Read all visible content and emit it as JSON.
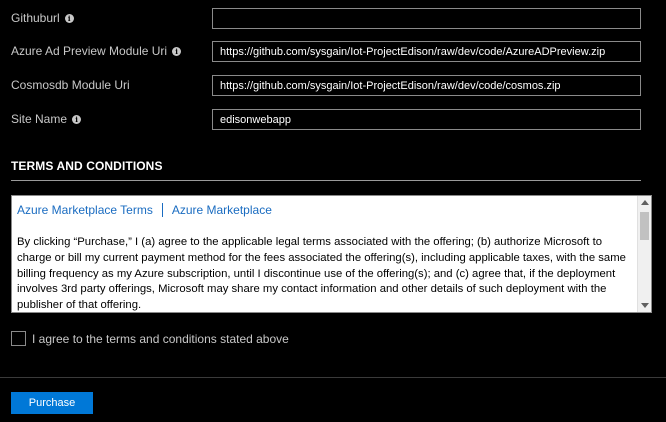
{
  "fields": [
    {
      "label": "Githuburl",
      "has_info": true,
      "value": ""
    },
    {
      "label": "Azure Ad Preview Module Uri",
      "has_info": true,
      "value": "https://github.com/sysgain/Iot-ProjectEdison/raw/dev/code/AzureADPreview.zip"
    },
    {
      "label": "Cosmosdb Module Uri",
      "has_info": false,
      "value": "https://github.com/sysgain/Iot-ProjectEdison/raw/dev/code/cosmos.zip"
    },
    {
      "label": "Site Name",
      "has_info": true,
      "value": "edisonwebapp"
    }
  ],
  "terms": {
    "heading": "TERMS AND CONDITIONS",
    "link_terms": "Azure Marketplace Terms",
    "link_marketplace": "Azure Marketplace",
    "body": "By clicking “Purchase,” I (a) agree to the applicable legal terms associated with the offering; (b) authorize Microsoft to charge or bill my current payment method for the fees associated the offering(s), including applicable taxes, with the same billing frequency as my Azure subscription, until I discontinue use of the offering(s); and (c) agree that, if the deployment involves 3rd party offerings, Microsoft may share my contact information and other details of such deployment with the publisher of that offering."
  },
  "agree": {
    "label": "I agree to the terms and conditions stated above",
    "checked": false
  },
  "purchase_button": "Purchase",
  "info_icon_glyph": "i",
  "colors": {
    "accent": "#0078d7",
    "link": "#1a6cc1",
    "background": "#000000"
  }
}
